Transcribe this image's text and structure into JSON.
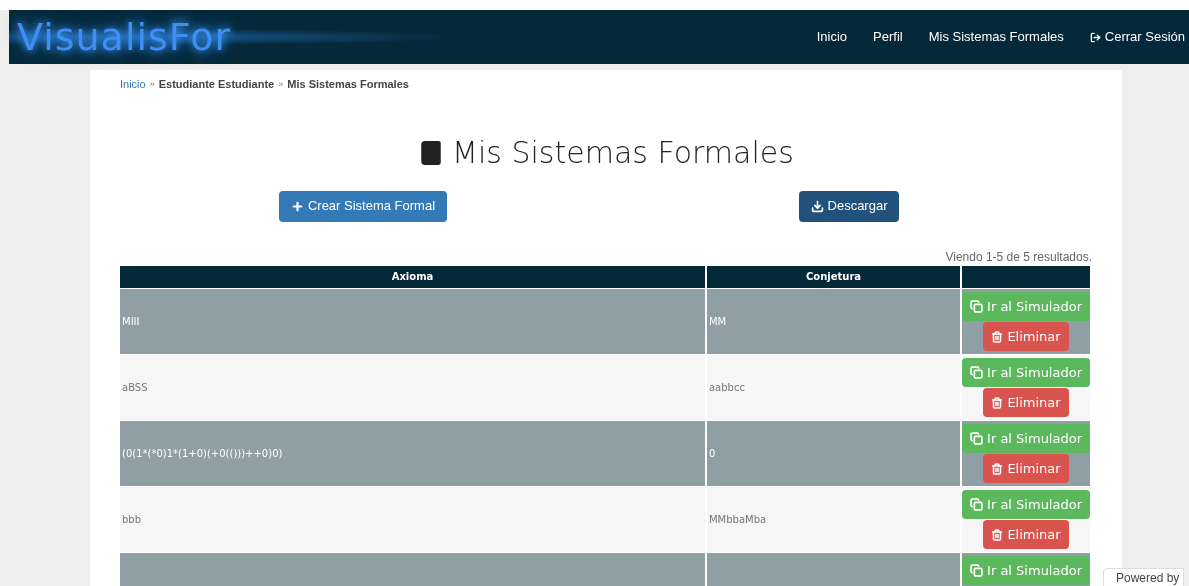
{
  "brand": "VisualisFor",
  "nav": [
    {
      "label": "Inicio",
      "kind": "link"
    },
    {
      "label": "Perfil",
      "kind": "link"
    },
    {
      "label": "Mis Sistemas Formales",
      "kind": "link"
    },
    {
      "label": "Cerrar Sesión",
      "kind": "logout"
    }
  ],
  "breadcrumb": [
    {
      "label": "Inicio",
      "kind": "link"
    },
    {
      "label": "Estudiante Estudiante",
      "kind": "text"
    },
    {
      "label": "Mis Sistemas Formales",
      "kind": "text"
    }
  ],
  "breadcrumb_separator": "»",
  "title": "Mis Sistemas Formales",
  "toolbar": [
    {
      "label": "Crear Sistema Formal",
      "kind": "create"
    },
    {
      "label": "Descargar",
      "kind": "download"
    }
  ],
  "summary": "Viendo 1-5 de 5 resultados.",
  "table": {
    "columns": [
      "Axioma",
      "Conjetura"
    ],
    "rows": [
      {
        "axioma": "MIII",
        "conjetura": "MM",
        "actions": [
          {
            "kind": "simulate",
            "label": "Ir al Simulador"
          },
          {
            "kind": "delete",
            "label": "Eliminar"
          }
        ]
      },
      {
        "axioma": "aBSS",
        "conjetura": "aabbcc",
        "actions": [
          {
            "kind": "simulate",
            "label": "Ir al Simulador"
          },
          {
            "kind": "delete",
            "label": "Eliminar"
          }
        ]
      },
      {
        "axioma": "(0(1*(*0)1*(1+0)(+0(()))++0)0)",
        "conjetura": "0",
        "actions": [
          {
            "kind": "simulate",
            "label": "Ir al Simulador"
          },
          {
            "kind": "delete",
            "label": "Eliminar"
          }
        ]
      },
      {
        "axioma": "bbb",
        "conjetura": "MMbbaMba",
        "actions": [
          {
            "kind": "simulate",
            "label": "Ir al Simulador"
          },
          {
            "kind": "delete",
            "label": "Eliminar"
          }
        ]
      },
      {
        "actions": [
          {
            "kind": "simulate",
            "label": "Ir al Simulador"
          }
        ]
      }
    ]
  },
  "badge": "Powered by"
}
